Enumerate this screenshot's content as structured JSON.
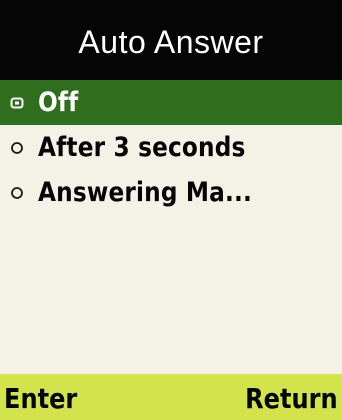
{
  "screen": {
    "title": "Auto Answer"
  },
  "options": [
    {
      "label": "Off",
      "selected": true
    },
    {
      "label": "After 3 seconds",
      "selected": false
    },
    {
      "label": "Answering Ma...",
      "selected": false
    }
  ],
  "softkeys": {
    "left": "Enter",
    "right": "Return"
  },
  "colors": {
    "title_bg": "#050505",
    "selection_bg": "#2f6e1d",
    "softkey_bg": "#d2e34c",
    "screen_bg": "#f3f2e6"
  },
  "icons": {
    "radio": "radio-circle-icon"
  }
}
